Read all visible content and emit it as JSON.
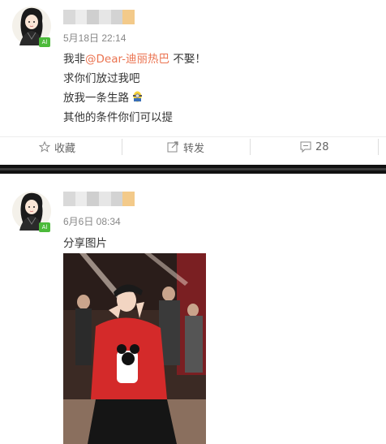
{
  "post1": {
    "avatar_icon": "user-avatar-icon",
    "badge": "Al",
    "time": "5月18日 22:14",
    "lines": {
      "line1_pre": "我非",
      "line1_mention": "@Dear-迪丽热巴",
      "line1_post": " 不娶！",
      "line2": "求你们放过我吧",
      "line3": "放我一条生路",
      "line4": "其他的条件你们可以提"
    },
    "emoji_icon": "bowing-minion-emoji-icon",
    "actions": {
      "favorite_label": "收藏",
      "forward_label": "转发",
      "comment_count": "28"
    }
  },
  "post2": {
    "avatar_icon": "user-avatar-icon",
    "badge": "Al",
    "time": "6月6日 08:34",
    "caption": "分享图片",
    "photo_icon": "shared-photo-image"
  },
  "colors": {
    "mention": "#eb7350",
    "time": "#888888",
    "text": "#333333",
    "badge": "#4cba3a",
    "divider": "#111111"
  }
}
